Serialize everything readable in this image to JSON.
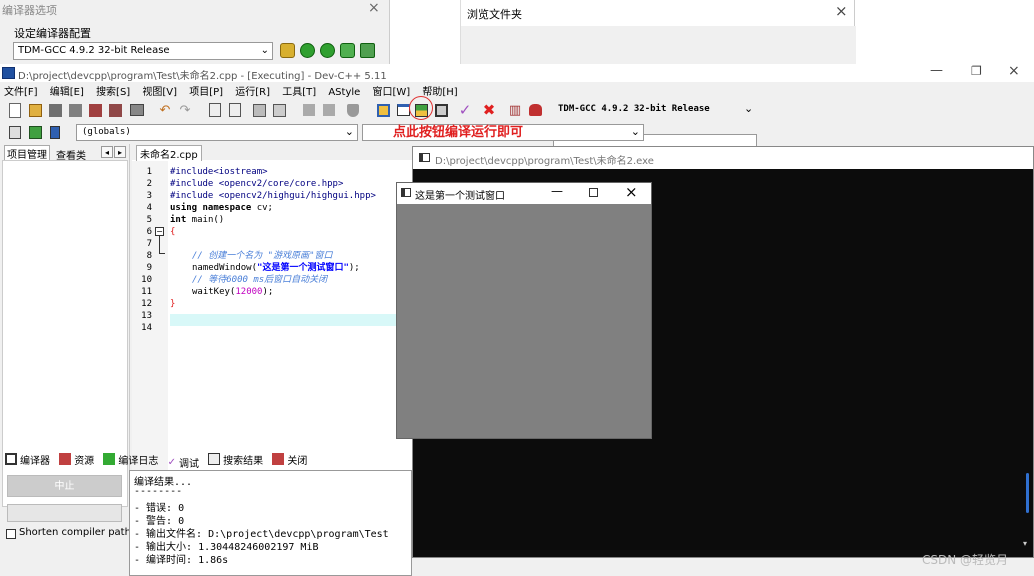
{
  "bg_compiler_options": {
    "title": "编译器选项",
    "group_label": "设定编译器配置",
    "selected_compiler": "TDM-GCC 4.9.2 32-bit Release"
  },
  "bg_browse_folder": {
    "title": "浏览文件夹"
  },
  "devcpp": {
    "title": "D:\\project\\devcpp\\program\\Test\\未命名2.cpp - [Executing] - Dev-C++ 5.11",
    "menu": [
      "文件[F]",
      "编辑[E]",
      "搜索[S]",
      "视图[V]",
      "项目[P]",
      "运行[R]",
      "工具[T]",
      "AStyle",
      "窗口[W]",
      "帮助[H]"
    ],
    "compiler_select": "TDM-GCC 4.9.2 32-bit Release",
    "globals_select": "(globals)",
    "annotation": "点此按钮编译运行即可",
    "left_tabs": [
      "项目管理",
      "查看类"
    ],
    "file_tab": "未命名2.cpp",
    "line_numbers": [
      "1",
      "2",
      "3",
      "4",
      "5",
      "6",
      "7",
      "8",
      "9",
      "10",
      "11",
      "12",
      "13",
      "14"
    ],
    "code": {
      "l1": "#include<iostream>",
      "l2": "#include <opencv2/core/core.hpp>",
      "l3": "#include <opencv2/highgui/highgui.hpp>",
      "l4_kw": "using namespace",
      "l4_rest": " cv;",
      "l5_kw": "int",
      "l5_rest": " main()",
      "l6": "{",
      "l8": "// 创建一个名为 \"游戏原画\"窗口",
      "l9_fn": "namedWindow(",
      "l9_str": "\"这是第一个测试窗口\"",
      "l9_end": ");",
      "l10": "// 等待6000 ms后窗口自动关闭",
      "l11_fn": "waitKey(",
      "l11_num": "12000",
      "l11_end": ");",
      "l12": "}"
    },
    "bottom_tabs": [
      "编译器",
      "资源",
      "编译日志",
      "调试",
      "搜索结果",
      "关闭"
    ],
    "abort_button": "中止",
    "shorten_label": "Shorten compiler paths",
    "log": [
      "编译结果...",
      "--------",
      "- 错误: 0",
      "- 警告: 0",
      "- 输出文件名: D:\\project\\devcpp\\program\\Test",
      "- 输出大小: 1.30448246002197 MiB",
      "- 编译时间: 1.86s"
    ]
  },
  "console": {
    "title": "D:\\project\\devcpp\\program\\Test\\未命名2.exe"
  },
  "cv_window": {
    "title": "这是第一个测试窗口"
  },
  "watermark": "CSDN @轻览月",
  "colors": {
    "keyword": "#000080",
    "comment": "#4a7fd8",
    "string": "#0000ff",
    "number": "#c000c0",
    "annotation": "#e02020",
    "console_bg": "#0c0c0c",
    "cv_canvas": "#808080"
  }
}
